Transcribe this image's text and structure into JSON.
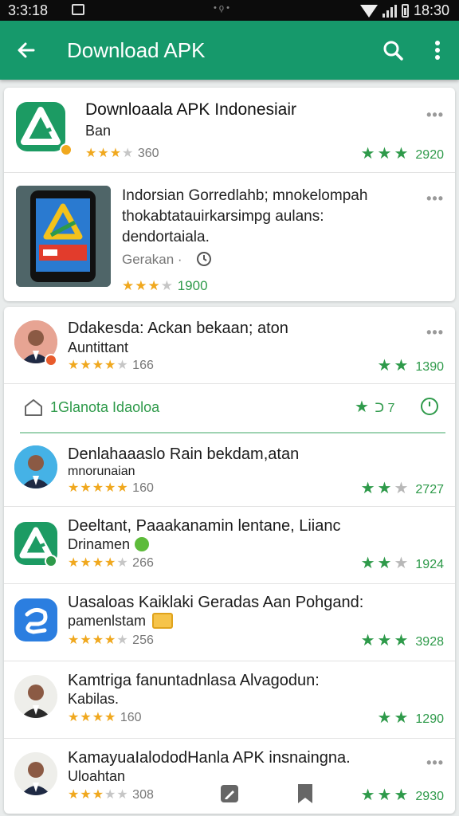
{
  "status_bar": {
    "time": "3:3:18",
    "center": "• ϙ •",
    "right_time": "18:30"
  },
  "app_bar": {
    "title": "Download APK"
  },
  "items": [
    {
      "title": "Downloaala APK Indonesiair",
      "subtitle": "Ban",
      "rating_count": "360",
      "right_count": "2920"
    },
    {
      "line1": "Indorsian Gorredlahb; mnokelompah",
      "line2": "thokabtatauirkarsimpg aulans:",
      "line3": "dendortaiala.",
      "meta": "Gerakan ·",
      "rating_count": "1900"
    },
    {
      "title": "Ddakesda: Ackan bekaan; aton",
      "subtitle": "Auntittant",
      "rating_count": "166",
      "right_count": "1390"
    },
    {
      "title": "Denlahaaaslo Rain bekdam,atan",
      "subtitle": "mnorunaian",
      "rating_count": "160",
      "right_count": "2727"
    },
    {
      "title": "Deeltant, Paaakanamin lentane, Liianc",
      "subtitle": "Drinamen",
      "rating_count": "266",
      "right_count": "1924"
    },
    {
      "title": "Uasaloas Kaiklaki Geradas Aan Pohgand:",
      "subtitle": "pamenlstam",
      "rating_count": "256",
      "right_count": "3928"
    },
    {
      "title": "Kamtriga fanuntadnlasa Alvagodun:",
      "subtitle": "Kabilas.",
      "rating_count": "160",
      "right_count": "1290"
    },
    {
      "title": "KamayuaIalododHanla APK insnaingna.",
      "subtitle": "Uloahtan",
      "rating_count": "308",
      "right_count": "2930"
    }
  ],
  "mini_bar": {
    "label": "1Glanota Idaoloa",
    "tail": "ᑐ 7"
  },
  "more_dots": "•••",
  "colors": {
    "primary": "#16996b",
    "star": "#f0a81e",
    "green_star": "#2e9a4a"
  },
  "icons": [
    "arrow-back-icon",
    "search-icon",
    "more-vert-icon",
    "house-icon",
    "clock-icon",
    "edit-icon",
    "bookmark-icon"
  ]
}
